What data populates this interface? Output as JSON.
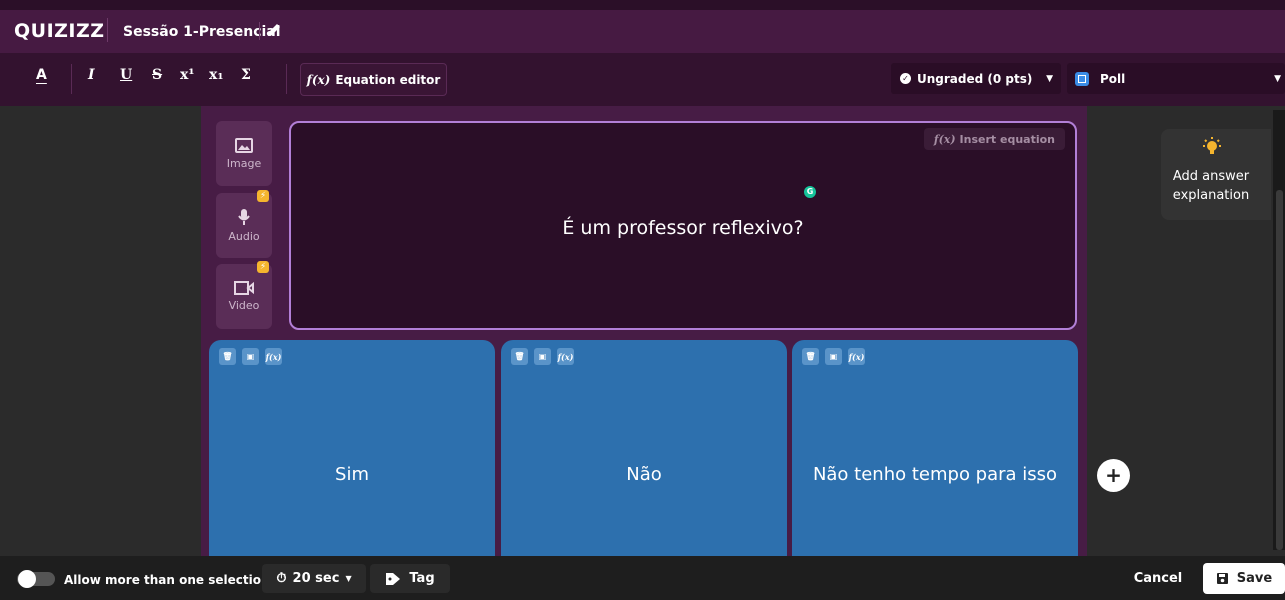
{
  "header": {
    "logo": "QUIZIZZ",
    "quiz_title": "Sessão 1-Presencial"
  },
  "toolbar": {
    "format_buttons": [
      "A",
      "I",
      "U",
      "S",
      "x¹",
      "x₁",
      "Σ"
    ],
    "equation_editor_label": "Equation editor",
    "grading_label": "Ungraded (0 pts)",
    "question_type_label": "Poll"
  },
  "media": {
    "image_label": "Image",
    "audio_label": "Audio",
    "video_label": "Video"
  },
  "question": {
    "insert_equation_label": "Insert equation",
    "text": "É um professor reflexivo?"
  },
  "options": [
    {
      "text": "Sim"
    },
    {
      "text": "Não"
    },
    {
      "text": "Não tenho tempo para isso"
    }
  ],
  "explanation": {
    "label": "Add answer explanation"
  },
  "footer": {
    "allow_multiple_label": "Allow more than one selection",
    "timer_label": "20 sec",
    "tag_label": "Tag",
    "cancel_label": "Cancel",
    "save_label": "Save"
  },
  "colors": {
    "header_bg": "#461a42",
    "option_bg": "#2d70ae",
    "question_border": "#b27fd7",
    "premium_badge": "#f5b52e"
  }
}
